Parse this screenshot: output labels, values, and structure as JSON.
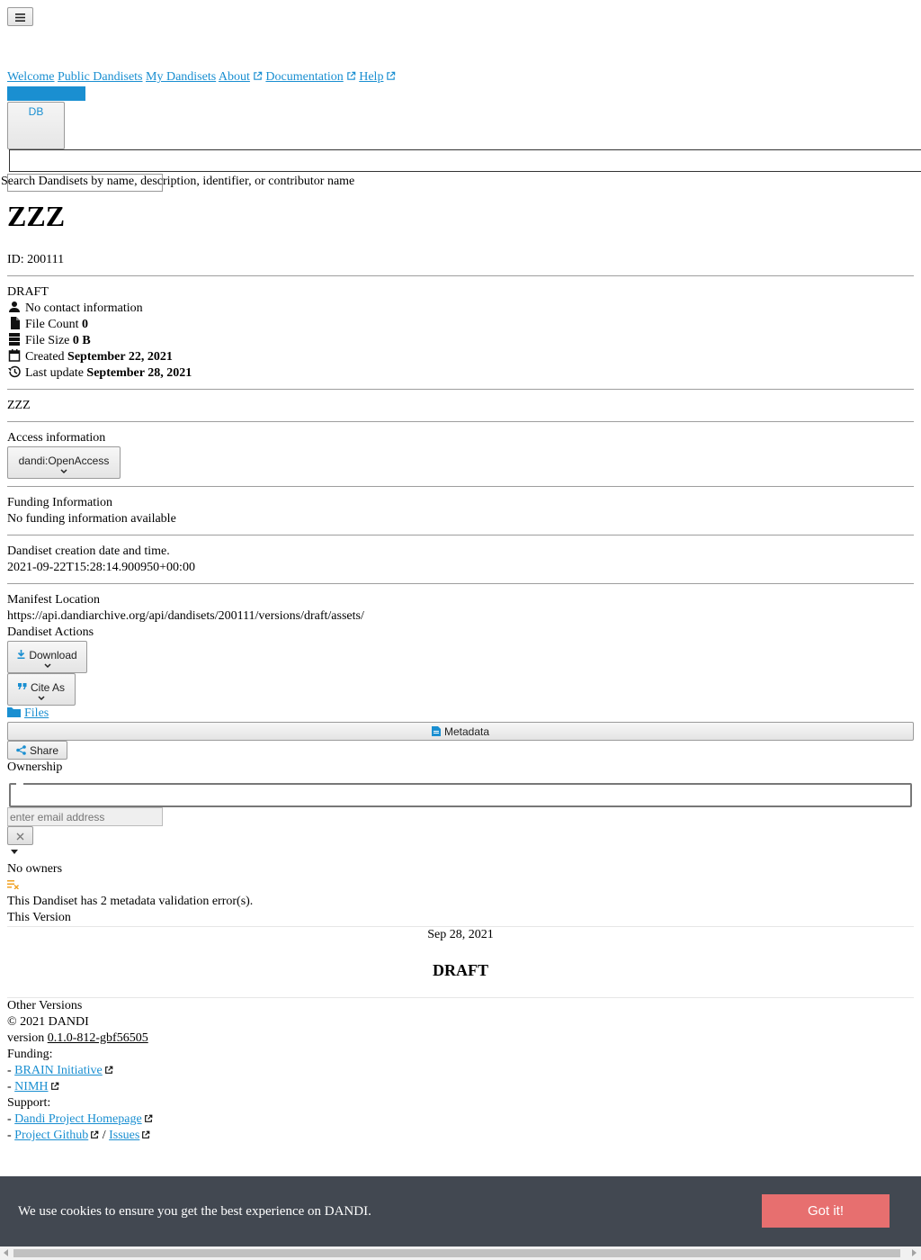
{
  "nav": {
    "menu_icon": "hamburger-menu-icon",
    "links": [
      "Welcome",
      "Public Dandisets",
      "My Dandisets",
      "About",
      "Documentation",
      "Help"
    ],
    "avatar_initials": "DB"
  },
  "search": {
    "label": "Search Dandisets by name, description, identifier, or contributor name"
  },
  "dandiset": {
    "title": "ZZZ",
    "id_text": "ID: 200111",
    "version_badge": "DRAFT",
    "contact": "No contact information",
    "file_count_label": "File Count",
    "file_count": "0",
    "file_size_label": "File Size",
    "file_size": "0 B",
    "created_label": "Created",
    "created": "September 22, 2021",
    "updated_label": "Last update",
    "updated": "September 28, 2021",
    "description": "ZZZ",
    "access_label": "Access information",
    "access_value": "dandi:OpenAccess",
    "funding_label": "Funding Information",
    "funding_value": "No funding information available",
    "creation_label": "Dandiset creation date and time.",
    "creation_value": "2021-09-22T15:28:14.900950+00:00",
    "manifest_label": "Manifest Location",
    "manifest_value": "https://api.dandiarchive.org/api/dandisets/200111/versions/draft/assets/"
  },
  "actions": {
    "title": "Dandiset Actions",
    "download": "Download",
    "cite": "Cite As",
    "files": "Files",
    "metadata": "Metadata",
    "share": "Share"
  },
  "ownership": {
    "title": "Ownership",
    "email_placeholder": "enter email address",
    "clear_icon": "close-icon",
    "none": "No owners"
  },
  "validation": {
    "text": "This Dandiset has 2 metadata validation error(s)."
  },
  "versions": {
    "this_label": "This Version",
    "date": "Sep 28, 2021",
    "name": "DRAFT",
    "other_label": "Other Versions"
  },
  "footer": {
    "copyright": "© 2021 DANDI",
    "version_prefix": "version",
    "version": "0.1.0-812-gbf56505",
    "funding_label": "Funding:",
    "brain": "BRAIN Initiative",
    "nimh": "NIMH",
    "support_label": "Support:",
    "homepage": "Dandi Project Homepage",
    "github": "Project Github",
    "issues": "Issues",
    "dash": "-",
    "slash": "/"
  },
  "cookie": {
    "message": "We use cookies to ensure you get the best experience on DANDI.",
    "button": "Got it!"
  },
  "colors": {
    "link": "#1a8fd1",
    "brand": "#1a8fd1",
    "cookie_bg": "#424851",
    "cookie_btn": "#e76f6f",
    "warning": "#f0a020"
  }
}
